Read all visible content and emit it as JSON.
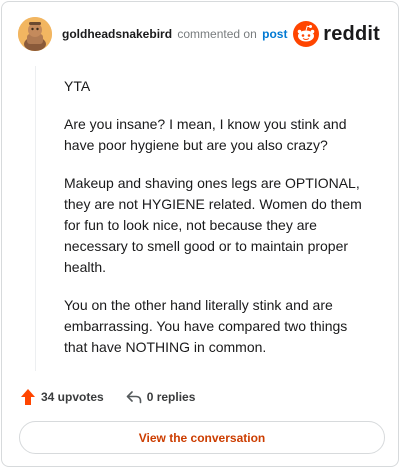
{
  "header": {
    "username": "goldheadsnakebird",
    "action_text": "commented on",
    "post_link": "post",
    "brand": "reddit"
  },
  "comment": {
    "paragraphs": [
      "YTA",
      "Are you insane? I mean, I know you stink and have poor hygiene but are you also crazy?",
      "Makeup and shaving ones legs are OPTIONAL, they are not HYGIENE related. Women do them for fun to look nice, not because they are necessary to smell good or to maintain proper health.",
      "You on the other hand literally stink and are embarrassing. You have compared two things that have NOTHING in common."
    ]
  },
  "actions": {
    "upvotes": "34 upvotes",
    "replies": "0 replies"
  },
  "cta": {
    "label": "View the conversation"
  },
  "colors": {
    "accent": "#ff4500",
    "cta_text": "#cc3d00",
    "link": "#0079d3",
    "border": "#d7dadc"
  },
  "icons": {
    "avatar": "snoo-avatar-icon",
    "brand": "reddit-logo-icon",
    "upvote": "upvote-arrow-icon",
    "reply": "reply-arrow-icon"
  }
}
